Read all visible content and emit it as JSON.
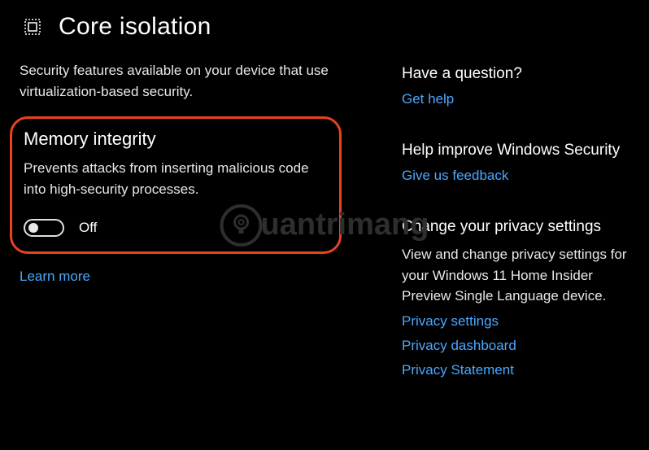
{
  "header": {
    "title": "Core isolation",
    "icon": "core-isolation-icon"
  },
  "left": {
    "intro": "Security features available on your device that use virtualization-based security.",
    "memory": {
      "title": "Memory integrity",
      "description": "Prevents attacks from inserting malicious code into high-security processes.",
      "toggle_state": "Off"
    },
    "learn_more": "Learn more"
  },
  "right": {
    "question": {
      "heading": "Have a question?",
      "link": "Get help"
    },
    "improve": {
      "heading": "Help improve Windows Security",
      "link": "Give us feedback"
    },
    "privacy": {
      "heading": "Change your privacy settings",
      "description": "View and change privacy settings for your Windows 11 Home Insider Preview Single Language device.",
      "links": {
        "settings": "Privacy settings",
        "dashboard": "Privacy dashboard",
        "statement": "Privacy Statement"
      }
    }
  },
  "watermark": {
    "text": "uantrimang"
  }
}
